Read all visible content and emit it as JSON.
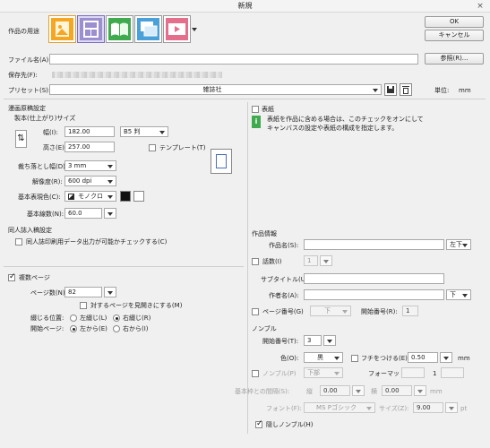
{
  "window": {
    "title": "新規",
    "close_glyph": "×"
  },
  "buttons": {
    "ok": "OK",
    "cancel": "キャンセル",
    "browse": "参照(R)..."
  },
  "usage": {
    "label": "作品の用途",
    "items": [
      {
        "name": "illustration",
        "color": "#f5a623"
      },
      {
        "name": "comic",
        "color": "#9b8fd0"
      },
      {
        "name": "book",
        "color": "#3faa4e"
      },
      {
        "name": "animation-cel",
        "color": "#4aa0d8"
      },
      {
        "name": "animation",
        "color": "#e36f8d"
      }
    ]
  },
  "file": {
    "name_label": "ファイル名(A):",
    "name_value": "",
    "save_label": "保存先(F):"
  },
  "preset": {
    "label": "プリセット(S):",
    "value": "雑誌社",
    "unit_label": "単位:",
    "unit_value": "mm"
  },
  "manga": {
    "section_title": "漫画原稿設定",
    "size_title": "製本(仕上がり)サイズ",
    "width_label": "幅(I):",
    "width_value": "182.00",
    "height_label": "高さ(E):",
    "height_value": "257.00",
    "paper_size": "B5 判",
    "template_label": "テンプレート(T)",
    "bleed_label": "裁ち落とし幅(D):",
    "bleed_value": "3 mm",
    "resolution_label": "解像度(R):",
    "resolution_value": "600 dpi",
    "color_label": "基本表現色(C):",
    "color_value": "モノクロ",
    "lines_label": "基本線数(N):",
    "lines_value": "60.0"
  },
  "doujin": {
    "section_title": "同人誌入稿設定",
    "check_label": "同人誌印刷用データ出力が可能かチェックする(C)"
  },
  "pages": {
    "multi_label": "複数ページ",
    "multi_checked": true,
    "count_label": "ページ数(N):",
    "count_value": "82",
    "spread_label": "対するページを見開きにする(M)",
    "binding_label": "綴じる位置:",
    "binding_left": "左綴じ(L)",
    "binding_right": "右綴じ(R)",
    "start_label": "開始ページ:",
    "start_left": "左から(E)",
    "start_right": "右から(I)"
  },
  "cover": {
    "label": "表紙",
    "info_line1": "表紙を作品に含める場合は、このチェックをオンにして",
    "info_line2": "キャンバスの設定や表紙の構成を指定します。"
  },
  "work_info": {
    "section_title": "作品情報",
    "title_label": "作品名(S):",
    "title_position": "左下",
    "episode_label": "話数(I)",
    "episode_value": "1",
    "subtitle_label": "サブタイトル(U):",
    "author_label": "作者名(A):",
    "author_position": "下",
    "pagenum_label": "ページ番号(G)",
    "pagenum_position": "下",
    "start_num_label": "開始番号(R):",
    "start_num_value": "1"
  },
  "nombre": {
    "section_title": "ノンブル",
    "start_label": "開始番号(T):",
    "start_value": "3",
    "color_label": "色(O):",
    "color_value": "黒",
    "border_label": "フチをつける(E)",
    "border_value": "0.50",
    "unit": "mm",
    "nombre_label": "ノンブル(P)",
    "nombre_position": "下部",
    "format_label": "フォーマット",
    "format_value": "1",
    "gap_label": "基本枠との間隔(S):",
    "gap_v_label": "縦",
    "gap_v_value": "0.00",
    "gap_h_label": "横",
    "gap_h_value": "0.00",
    "font_label": "フォント(F):",
    "font_value": "MS Pゴシック",
    "size_label": "サイズ(Z):",
    "size_value": "9.00",
    "size_unit": "pt",
    "hidden_label": "隠しノンブル(H)"
  }
}
